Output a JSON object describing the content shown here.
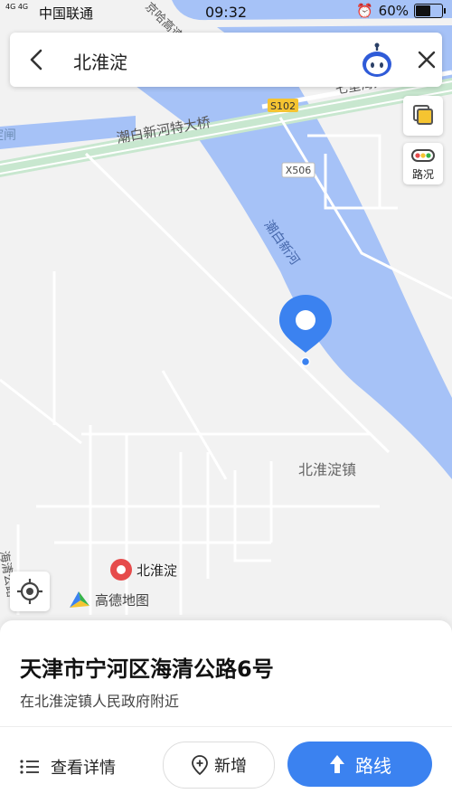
{
  "status_bar": {
    "network": "4G 4G",
    "carrier": "中国联通",
    "time": "09:32",
    "battery_text": "60%",
    "battery_level": 0.6
  },
  "search": {
    "query": "北淮淀"
  },
  "map": {
    "labels": {
      "bridge": "潮白新河特大桥",
      "road_s102": "S102",
      "road_x506": "X506",
      "river": "潮白新河",
      "town": "北淮淀镇",
      "qilihai": "七里海大道",
      "gate": "淀闸",
      "top_road": "京哈高速",
      "left_road": "海清公路"
    },
    "poi": "北淮淀",
    "logo_text": "高德地图",
    "traffic_label": "路况",
    "colors": {
      "water": "#a6c2f7",
      "land": "#f2f2f2",
      "road": "#ffffff",
      "highway_green": "#c8e7cf",
      "accent": "#3b82f0",
      "poi_red": "#e64b4b"
    }
  },
  "result": {
    "address": "天津市宁河区海清公路6号",
    "nearby": "在北淮淀镇人民政府附近",
    "details_label": "查看详情",
    "add_label": "新增",
    "route_label": "路线"
  }
}
